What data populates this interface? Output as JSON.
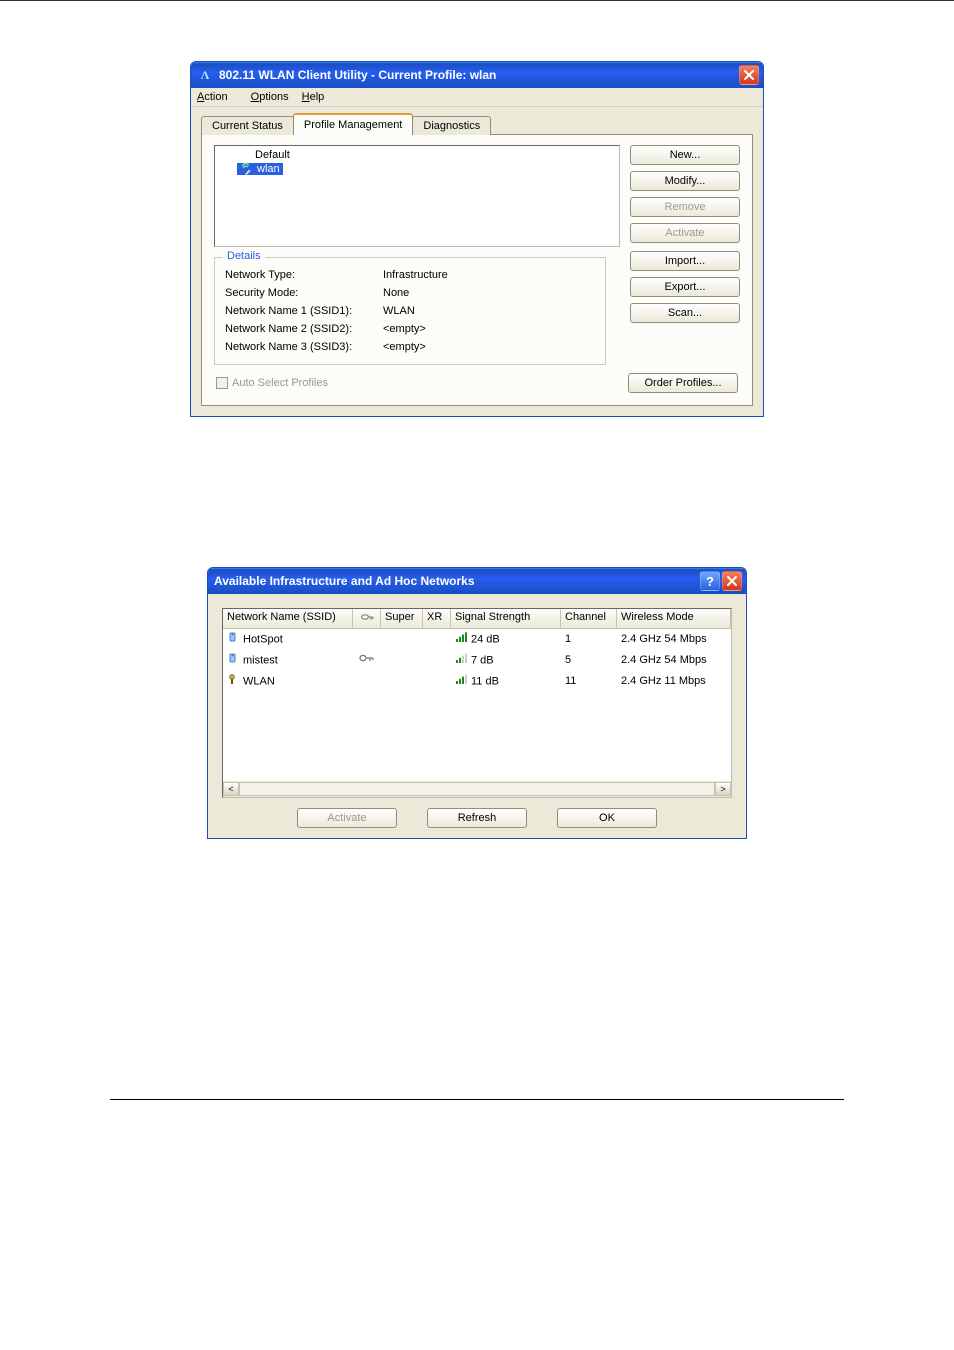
{
  "mainWindow": {
    "title": "802.11 WLAN Client Utility - Current Profile: wlan",
    "menu": {
      "action": "Action",
      "options": "Options",
      "help": "Help"
    },
    "tabs": {
      "status": "Current Status",
      "profile": "Profile Management",
      "diag": "Diagnostics"
    },
    "profiles": {
      "default": "Default",
      "wlan": "wlan"
    },
    "buttons": {
      "new": "New...",
      "modify": "Modify...",
      "remove": "Remove",
      "activate": "Activate",
      "import": "Import...",
      "export": "Export...",
      "scan": "Scan...",
      "order": "Order Profiles..."
    },
    "details": {
      "legend": "Details",
      "netTypeLabel": "Network Type:",
      "netType": "Infrastructure",
      "secModeLabel": "Security Mode:",
      "secMode": "None",
      "ssid1Label": "Network Name 1 (SSID1):",
      "ssid1": "WLAN",
      "ssid2Label": "Network Name 2 (SSID2):",
      "ssid2": "<empty>",
      "ssid3Label": "Network Name 3 (SSID3):",
      "ssid3": "<empty>"
    },
    "autoSelect": "Auto Select Profiles"
  },
  "scanWindow": {
    "title": "Available Infrastructure and Ad Hoc Networks",
    "columns": {
      "ssid": "Network Name (SSID)",
      "sec": "",
      "super": "Super",
      "xr": "XR",
      "signal": "Signal Strength",
      "channel": "Channel",
      "mode": "Wireless Mode"
    },
    "rows": [
      {
        "icon": "infra",
        "ssid": "HotSpot",
        "sec": "",
        "super": "",
        "xr": "",
        "sigIcon": "4",
        "signal": "24 dB",
        "channel": "1",
        "mode": "2.4 GHz 54 Mbps"
      },
      {
        "icon": "infra",
        "ssid": "mistest",
        "sec": "key",
        "super": "",
        "xr": "",
        "sigIcon": "2",
        "signal": "7 dB",
        "channel": "5",
        "mode": "2.4 GHz 54 Mbps"
      },
      {
        "icon": "adhoc",
        "ssid": "WLAN",
        "sec": "",
        "super": "",
        "xr": "",
        "sigIcon": "3",
        "signal": "11 dB",
        "channel": "11",
        "mode": "2.4 GHz 11 Mbps"
      }
    ],
    "buttons": {
      "activate": "Activate",
      "refresh": "Refresh",
      "ok": "OK"
    }
  }
}
